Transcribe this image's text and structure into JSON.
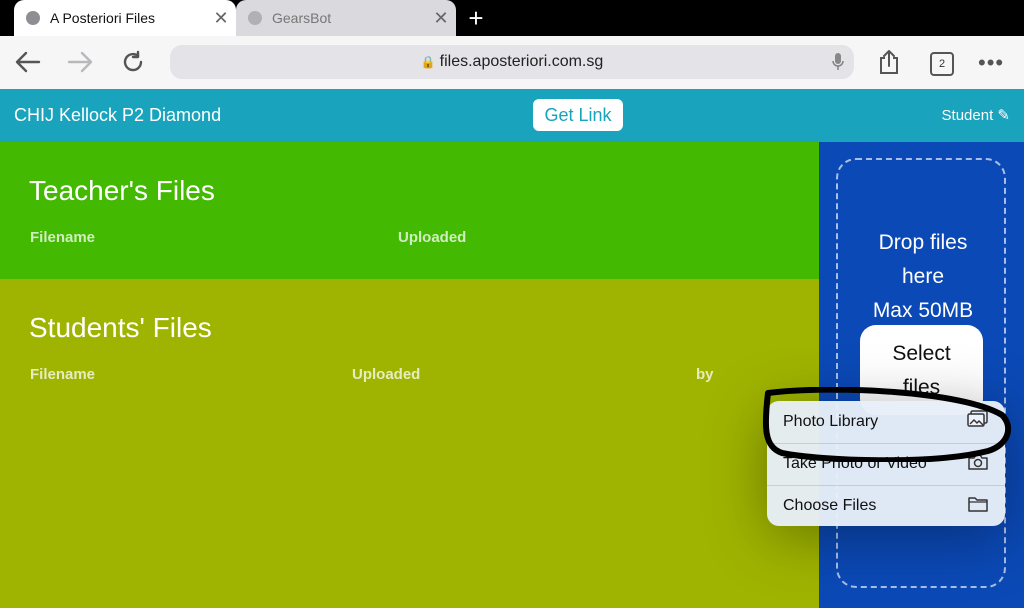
{
  "browser": {
    "tabs": [
      {
        "title": "A Posteriori Files",
        "active": true
      },
      {
        "title": "GearsBot",
        "active": false
      }
    ],
    "url": "files.aposteriori.com.sg",
    "tab_count": "2"
  },
  "app": {
    "class_name": "CHIJ Kellock P2 Diamond",
    "get_link": "Get Link",
    "role": "Student",
    "accent": "#1aa3bc"
  },
  "teacher_files": {
    "title": "Teacher's Files",
    "columns": [
      "Filename",
      "Uploaded"
    ]
  },
  "student_files": {
    "title": "Students' Files",
    "columns": [
      "Filename",
      "Uploaded",
      "by"
    ]
  },
  "upload": {
    "drop_line1": "Drop files",
    "drop_line2": "here",
    "max_size": "Max 50MB",
    "select_line1": "Select",
    "select_line2": "files"
  },
  "picker_menu": {
    "items": [
      {
        "label": "Photo Library",
        "icon": "photo-library-icon"
      },
      {
        "label": "Take Photo or Video",
        "icon": "camera-icon"
      },
      {
        "label": "Choose Files",
        "icon": "folder-icon"
      }
    ]
  }
}
